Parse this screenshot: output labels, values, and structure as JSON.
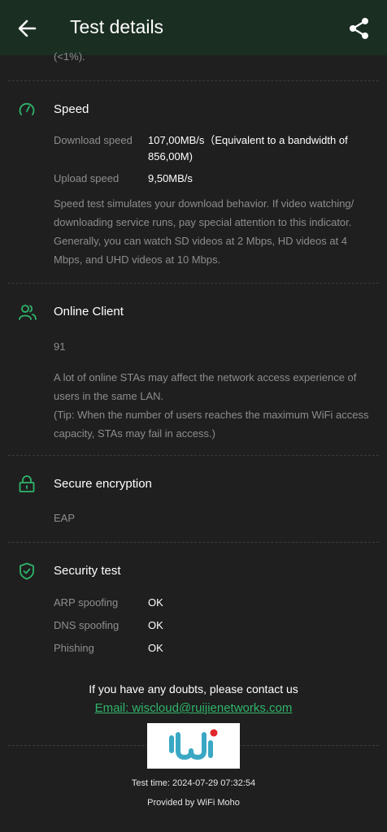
{
  "header": {
    "title": "Test details",
    "back_icon": "arrow-left-icon",
    "share_icon": "share-icon"
  },
  "truncated_text": "(<1%).",
  "speed": {
    "title": "Speed",
    "icon": "speedometer-icon",
    "download_label": "Download speed",
    "download_value": "107,00MB/s（Equivalent to a bandwidth of 856,00M)",
    "upload_label": "Upload speed",
    "upload_value": "9,50MB/s",
    "description": "Speed test simulates your download behavior. If video watching/ downloading service runs, pay special attention to this indicator. Generally, you can watch SD videos at 2 Mbps, HD videos at 4 Mbps, and UHD videos at 10 Mbps."
  },
  "online_client": {
    "title": "Online Client",
    "icon": "users-icon",
    "value": "91",
    "description": "A lot of online STAs may affect the network access experience of users in the same LAN.",
    "tip": "(Tip: When the number of users reaches the maximum WiFi access capacity, STAs may fail in access.)"
  },
  "encryption": {
    "title": "Secure encryption",
    "icon": "lock-icon",
    "value": "EAP"
  },
  "security": {
    "title": "Security test",
    "icon": "shield-check-icon",
    "rows": [
      {
        "label": "ARP spoofing",
        "value": "OK"
      },
      {
        "label": "DNS spoofing",
        "value": "OK"
      },
      {
        "label": "Phishing",
        "value": "OK"
      }
    ]
  },
  "contact": {
    "text": "If you have any doubts, please contact us",
    "email": "Email: wiscloud@ruijienetworks.com"
  },
  "footer": {
    "test_time": "Test time: 2024-07-29 07:32:54",
    "provided_by": "Provided by WiFi Moho"
  },
  "colors": {
    "accent": "#2fb56a",
    "header_bg": "#1a2e22",
    "background": "#1f1f1f"
  }
}
